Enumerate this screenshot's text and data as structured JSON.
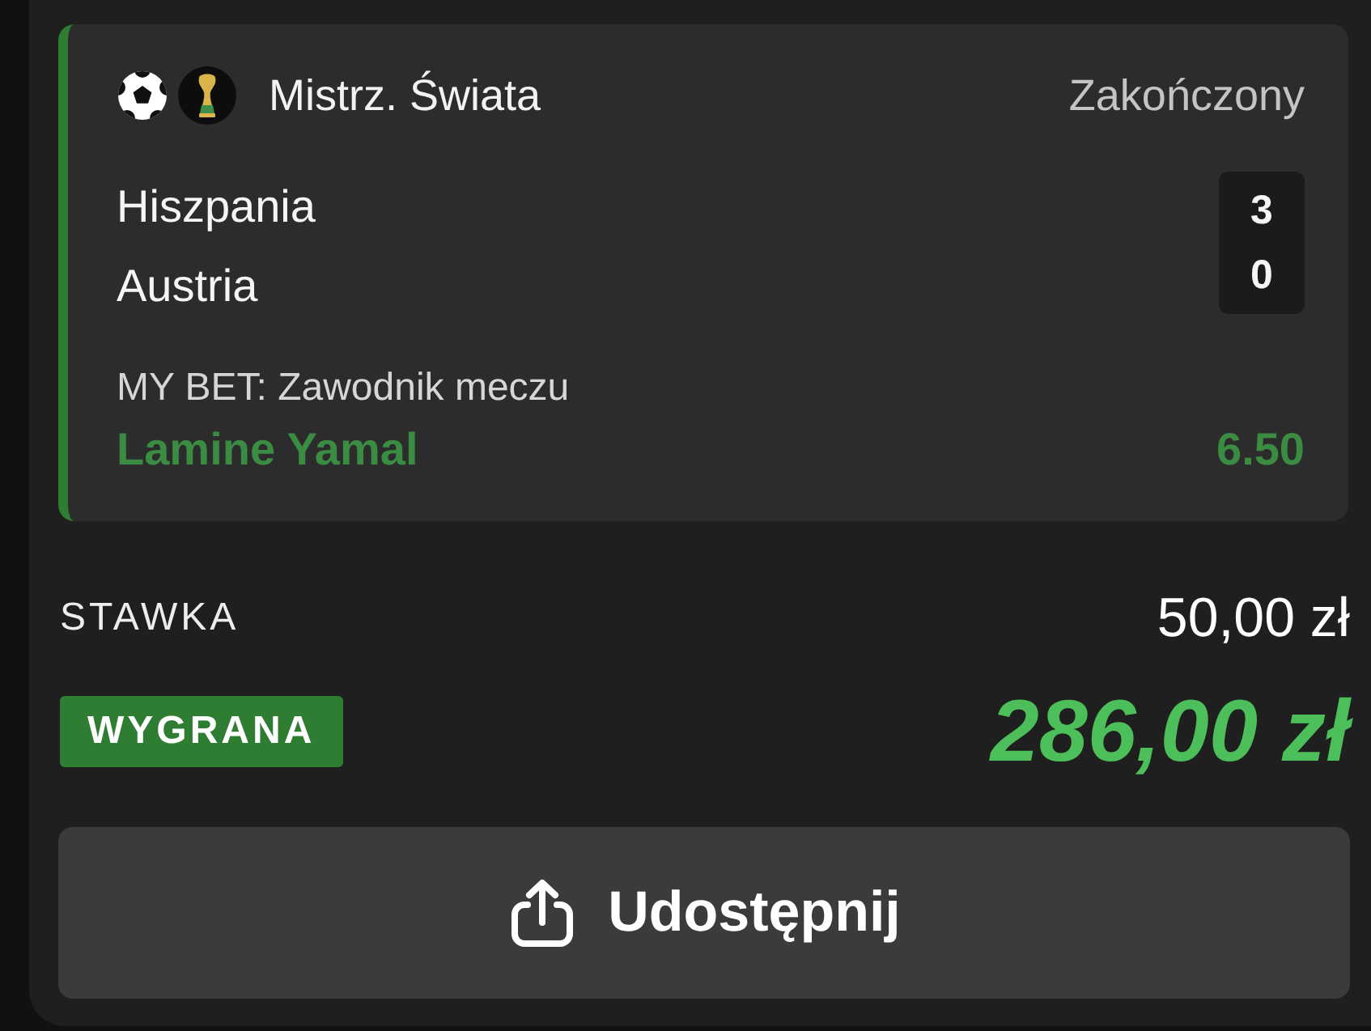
{
  "match": {
    "competition": "Mistrz. Świata",
    "status": "Zakończony",
    "teams": [
      {
        "name": "Hiszpania",
        "score": "3"
      },
      {
        "name": "Austria",
        "score": "0"
      }
    ],
    "bet_label": "MY BET: Zawodnik meczu",
    "selection": "Lamine Yamal",
    "odds": "6.50",
    "won": true
  },
  "stake": {
    "label": "STAWKA",
    "amount": "50,00 zł"
  },
  "payout": {
    "status": "WYGRANA",
    "amount": "286,00 zł"
  },
  "share_button": {
    "label": "Udostępnij"
  }
}
